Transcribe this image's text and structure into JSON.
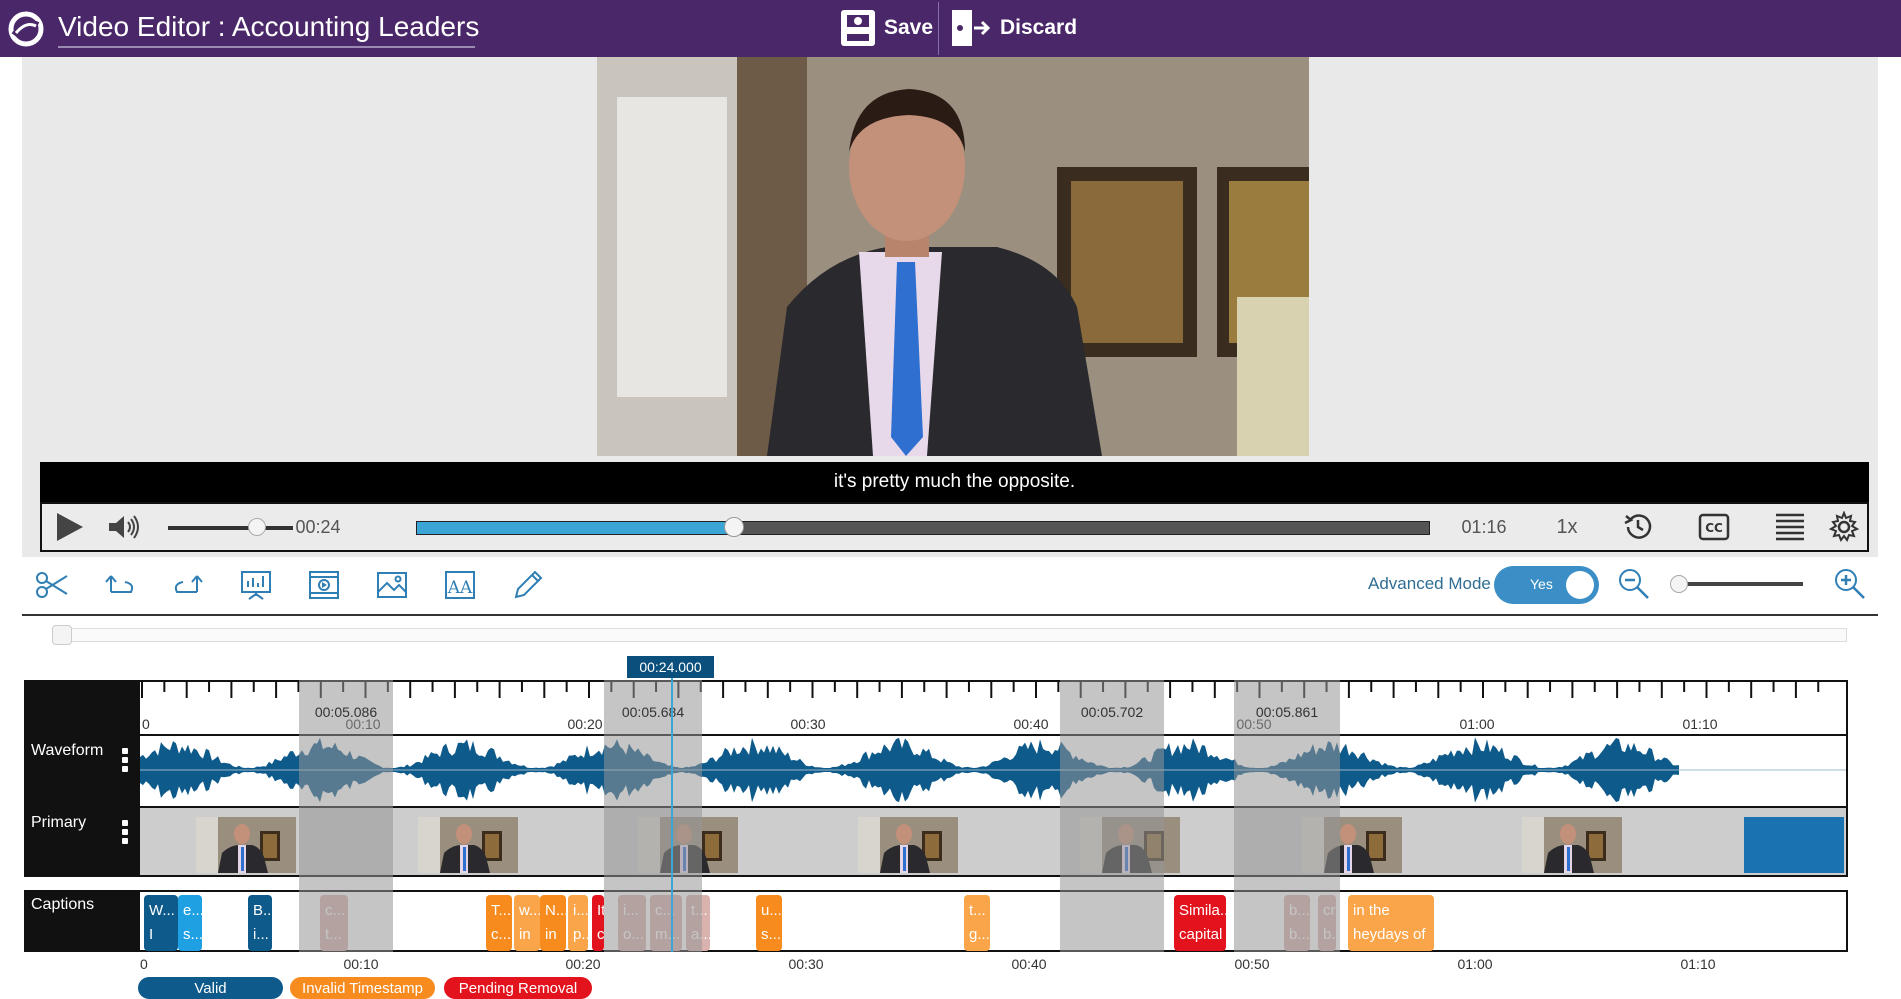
{
  "header": {
    "title": "Video Editor : Accounting Leaders",
    "save_label": "Save",
    "discard_label": "Discard",
    "accent_color": "#4a2769"
  },
  "player": {
    "caption_text": "it's pretty much the opposite.",
    "current_time": "00:24",
    "duration": "01:16",
    "speed": "1x",
    "progress_fraction": 0.31,
    "volume_fraction": 0.7,
    "icons": [
      "play-icon",
      "volume-icon",
      "history-icon",
      "cc-icon",
      "list-icon",
      "gear-icon"
    ]
  },
  "toolbar": {
    "tools": [
      "scissors-icon",
      "undo-icon",
      "redo-icon",
      "presentation-icon",
      "video-clip-icon",
      "image-icon",
      "text-icon",
      "pencil-icon"
    ],
    "advanced_mode_label": "Advanced Mode",
    "advanced_mode_value": "Yes",
    "zoom_fraction": 0.0
  },
  "timeline": {
    "playhead_label": "00:24.000",
    "ruler_ticks": [
      "0",
      "00:10",
      "00:20",
      "00:30",
      "00:40",
      "00:50",
      "01:00",
      "01:10"
    ],
    "gap_labels": [
      "00:05.086",
      "00:05.684",
      "00:05.702",
      "00:05.861"
    ],
    "tracks": {
      "waveform": "Waveform",
      "primary": "Primary",
      "captions": "Captions"
    },
    "caption_blocks": [
      {
        "line1": "W...",
        "line2": "I",
        "status": "valid"
      },
      {
        "line1": "e...",
        "line2": "s...",
        "status": "valid-light"
      },
      {
        "line1": "B...",
        "line2": "i...",
        "status": "valid"
      },
      {
        "line1": "c...",
        "line2": "t...",
        "status": "removed"
      },
      {
        "line1": "T...",
        "line2": "c...",
        "status": "invalid"
      },
      {
        "line1": "w...",
        "line2": "in",
        "status": "invalid-light"
      },
      {
        "line1": "N...",
        "line2": "in",
        "status": "invalid"
      },
      {
        "line1": "i...",
        "line2": "p...",
        "status": "invalid-light"
      },
      {
        "line1": "It's",
        "line2": "c",
        "status": "pending"
      },
      {
        "line1": "i...",
        "line2": "o...",
        "status": "removed"
      },
      {
        "line1": "c...",
        "line2": "m...",
        "status": "removed"
      },
      {
        "line1": "t...",
        "line2": "a...",
        "status": "removed"
      },
      {
        "line1": "u...",
        "line2": "s...",
        "status": "invalid"
      },
      {
        "line1": "t...",
        "line2": "g...",
        "status": "invalid-light"
      },
      {
        "line1": "Simila...",
        "line2": "capital",
        "status": "pending"
      },
      {
        "line1": "b...",
        "line2": "b...",
        "status": "removed"
      },
      {
        "line1": "cr...",
        "line2": "b...",
        "status": "removed"
      },
      {
        "line1": "in the",
        "line2": "heydays of",
        "status": "invalid-light"
      }
    ],
    "bottom_ticks": [
      "0",
      "00:10",
      "00:20",
      "00:30",
      "00:40",
      "00:50",
      "01:00",
      "01:10"
    ]
  },
  "legend": {
    "valid": "Valid",
    "invalid": "Invalid Timestamp",
    "pending": "Pending Removal",
    "colors": {
      "valid": "#0e5a8a",
      "invalid": "#f78b1e",
      "pending": "#e3131d"
    }
  }
}
